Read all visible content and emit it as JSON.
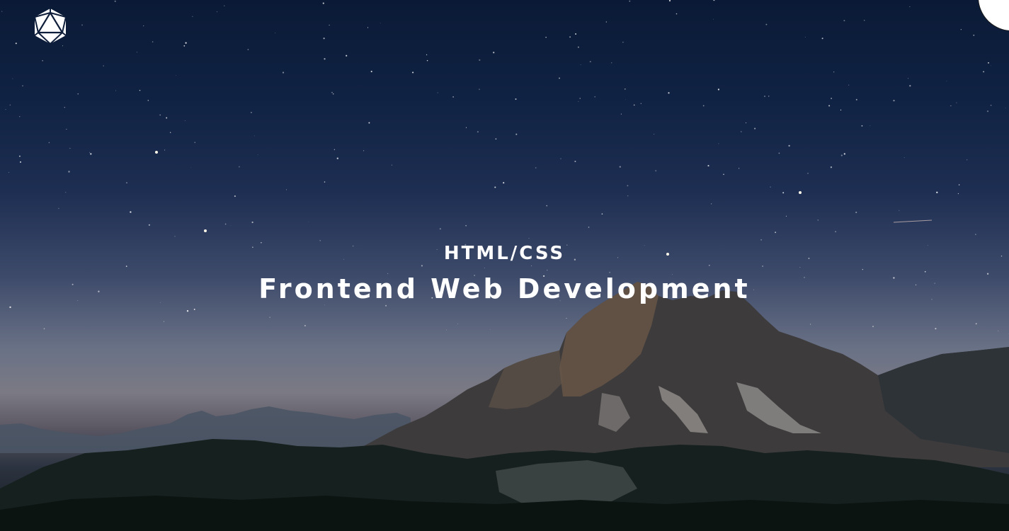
{
  "hero": {
    "subtitle": "HTML/CSS",
    "title": "Frontend Web Development"
  },
  "icons": {
    "logo": "icosahedron-logo-icon",
    "menu": "menu-circle-button"
  },
  "colors": {
    "sky_top": "#0a1a36",
    "horizon": "#7b7a84",
    "mountain": "#3c3a3a",
    "text": "#ffffff"
  }
}
